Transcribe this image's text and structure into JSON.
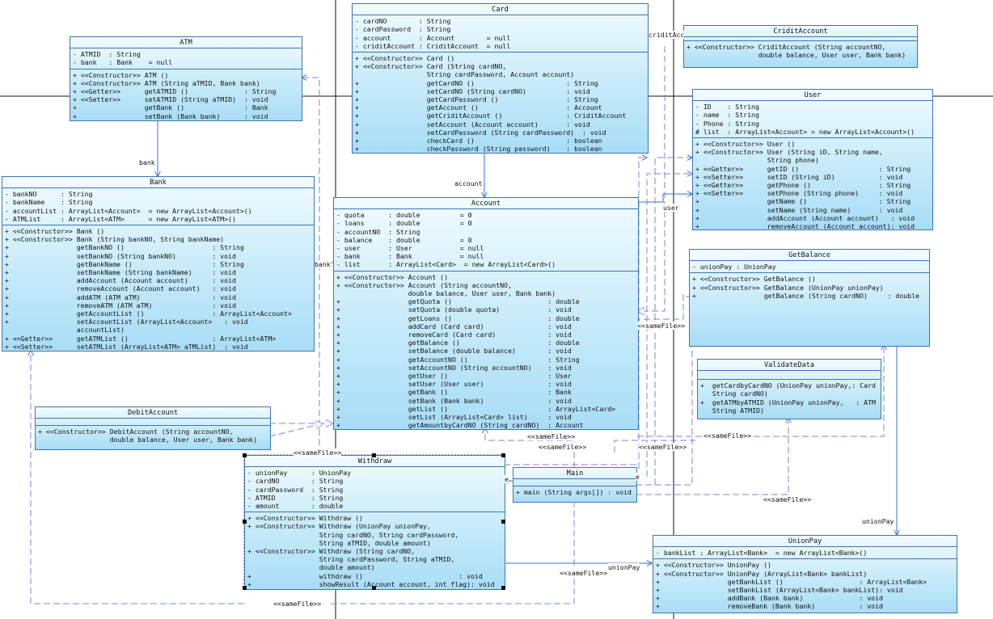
{
  "classes": {
    "atm": {
      "name": "ATM",
      "attributes": [
        "- ATMID  : String",
        "- bank   : Bank    = null"
      ],
      "operations": [
        "+ <<Constructor>> ATM ()",
        "+ <<Constructor>> ATM (String aTMID, Bank bank)",
        "+ <<Getter>>      getATMID ()              : String",
        "+ <<Setter>>      setATMID (String aTMID)  : void",
        "+                 getBank ()               : Bank",
        "+                 setBank (Bank bank)      : void"
      ]
    },
    "card": {
      "name": "Card",
      "attributes": [
        "- cardNO        : String",
        "- cardPassword  : String",
        "- account       : Account        = null",
        "- criditAccount : CriditAccount  = null"
      ],
      "operations": [
        "+ <<Constructor>> Card ()",
        "+ <<Constructor>> Card (String cardNO,",
        "                  String cardPassword, Account account)",
        "+                 getCardNO ()                       : String",
        "+                 setCardNO (String cardNO)          : void",
        "+                 getCardPassword ()                 : String",
        "+                 getAccount ()                      : Account",
        "+                 getCriditAccount ()                : CriditAccount",
        "+                 setAccount (Account account)       : void",
        "+                 setCardPassword (String cardPassword)  : void",
        "+                 checkCard ()                       : boolean",
        "+                 checkPassword (String password)    : boolean"
      ]
    },
    "cridit_account": {
      "name": "CriditAccount",
      "attributes": [],
      "operations": [
        "+ <<Constructor>> CriditAccount (String accountNO,",
        "                  double balance, User user, Bank bank)"
      ]
    },
    "user": {
      "name": "User",
      "attributes": [
        "- ID    : String",
        "- name  : String",
        "- Phone : String",
        "# list  : ArrayList<Account> = new ArrayList<Account>()"
      ],
      "operations": [
        "+ <<Constructor>> User ()",
        "+ <<Constructor>> User (String iD, String name,",
        "                  String phone)",
        "+ <<Getter>>      getID ()                    : String",
        "+ <<Setter>>      setID (String iD)           : void",
        "+ <<Getter>>      getPhone ()                 : String",
        "+ <<Setter>>      setPhone (String phone)     : void",
        "+                 getName ()                  : String",
        "+                 setName (String name)       : void",
        "+                 addAccount (Account account)   : void",
        "+                 removeAccount (Account account): void"
      ]
    },
    "bank": {
      "name": "Bank",
      "attributes": [
        "- bankNO      : String",
        "- bankName    : String",
        "- accountList : ArrayList<Account>  = new ArrayList<Account>()",
        "- ATMList     : ArrayList<ATM>      = new ArrayList<ATM>()"
      ],
      "operations": [
        "+ <<Constructor>> Bank ()",
        "+ <<Constructor>> Bank (String bankNO, String bankName)",
        "+                 getBankNO ()                      : String",
        "+                 setBankNO (String bankNO)         : void",
        "+                 getBankName ()                    : String",
        "+                 setBankName (String bankName)     : void",
        "+                 addAccount (Account account)      : void",
        "+                 removeAccount (Account account)   : void",
        "+                 addATM (ATM aTM)                  : void",
        "+                 removeATM (ATM aTM)               : void",
        "+                 getAccountList ()                 : ArrayList<Account>",
        "+                 setAccountList (ArrayList<Account>   : void",
        "                  accountList)",
        "+ <<Getter>>      getATMList ()                     : ArrayList<ATM>",
        "+ <<Setter>>      setATMList (ArrayList<ATM> aTMList)  : void"
      ]
    },
    "account": {
      "name": "Account",
      "attributes": [
        "- quota      : double          = 0",
        "- loans      : double          = 0",
        "- accountNO  : String",
        "- balance    : double          = 0",
        "- user       : User            = null",
        "- bank       : Bank            = null",
        "- list       : ArrayList<Card>  = new ArrayList<Card>()"
      ],
      "operations": [
        "+ <<Constructor>> Account ()",
        "+ <<Constructor>> Account (String accountNO,",
        "                  double balance, User user, Bank bank)",
        "+                 getQuota ()                        : double",
        "+                 setQuota (double quota)            : void",
        "+                 getLoans ()                        : double",
        "+                 addCard (Card card)                : void",
        "+                 removeCard (Card card)             : void",
        "+                 getBalance ()                      : double",
        "+                 setBalance (double balance)        : void",
        "+                 getAccountNO ()                    : String",
        "+                 setAccountNO (String accountNO)    : void",
        "+                 getUser ()                         : User",
        "+                 setUser (User user)                : void",
        "+                 getBank ()                         : Bank",
        "+                 setBank (Bank bank)                : void",
        "+                 getList ()                         : ArrayList<Card>",
        "+                 setList (ArrayList<Card> list)     : void",
        "+                 getAmountbyCardNO (String cardNO)  : Account"
      ]
    },
    "get_balance": {
      "name": "GetBalance",
      "attributes": [
        "- unionPay : UnionPay"
      ],
      "operations": [
        "+ <<Constructor>> GetBalance ()",
        "+ <<Constructor>> GetBalance (UnionPay unionPay)",
        "+                 getBalance (String cardNO)     : double"
      ]
    },
    "validate_data": {
      "name": "ValidateData",
      "attributes": [],
      "operations": [
        "+  getCardbyCardNO (UnionPay unionPay,: Card",
        "   String cardNO)",
        "+  getATMbyATMID (UnionPay unionPay,   : ATM",
        "   String ATMID)"
      ]
    },
    "debit_account": {
      "name": "DebitAccount",
      "attributes": [],
      "operations": [
        "+ <<Constructor>> DebitAccount (String accountNO,",
        "                  double balance, User user, Bank bank)"
      ]
    },
    "withdraw": {
      "name": "Withdraw",
      "attributes": [
        "- unionPay      : UnionPay",
        "- cardNO        : String",
        "- cardPassword  : String",
        "- ATMID         : String",
        "- amount        : double"
      ],
      "operations": [
        "+ <<Constructor>> Withdraw ()",
        "+ <<Constructor>> Withdraw (UnionPay unionPay,",
        "                  String cardNO, String cardPassword,",
        "                  String aTMID, double amount)",
        "+ <<Constructor>> Withdraw (String cardNO,",
        "                  String cardPassword, String aTMID,",
        "                  double amount)",
        "+                 withdraw ()                        : void",
        "+                 showResult (Account account, int flag): void"
      ]
    },
    "main": {
      "name": "Main",
      "attributes": [],
      "operations": [
        "+ main (String args[]) : void"
      ]
    },
    "union_pay": {
      "name": "UnionPay",
      "attributes": [
        "- bankList : ArrayList<Bank>  = new ArrayList<Bank>()"
      ],
      "operations": [
        "+ <<Constructor>> UnionPay ()",
        "+ <<Constructor>> UnionPay (ArrayList<Bank> bankList)",
        "+                 getBankList ()                   : ArrayList<Bank>",
        "+                 setBankList (ArrayList<Bank> bankList): void",
        "+                 addBank (Bank bank)              : void",
        "+                 removeBank (Bank bank)           : void"
      ]
    }
  },
  "labels": {
    "bank": "bank",
    "bank2": "bank",
    "account": "account",
    "user": "user",
    "cridit_account": "criditAcc",
    "union_pay": "unionPay",
    "union_pay2": "unionPay",
    "e1": "e",
    "e2": "e",
    "same_file": "<<sameFile>>"
  },
  "colors": {
    "line": "#3b6fd1",
    "dashed": "#7e86d8",
    "border": "#3f74b5",
    "frame": "#111111"
  }
}
